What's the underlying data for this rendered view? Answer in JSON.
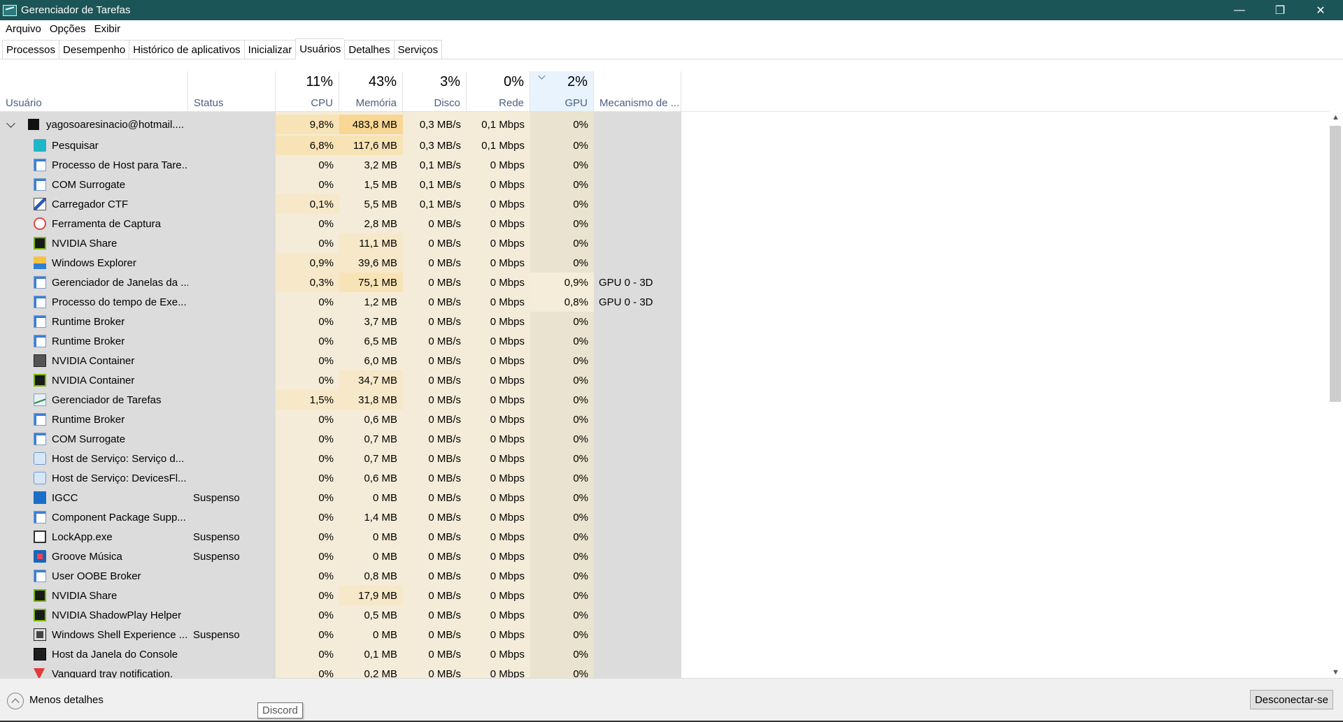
{
  "window": {
    "title": "Gerenciador de Tarefas",
    "minimize": "—",
    "restore": "❐",
    "close": "✕"
  },
  "menu": [
    "Arquivo",
    "Opções",
    "Exibir"
  ],
  "tabs": [
    "Processos",
    "Desempenho",
    "Histórico de aplicativos",
    "Inicializar",
    "Usuários",
    "Detalhes",
    "Serviços"
  ],
  "active_tab": "Usuários",
  "header": {
    "user": "Usuário",
    "status": "Status",
    "cpu_pct": "11%",
    "cpu": "CPU",
    "mem_pct": "43%",
    "mem": "Memória",
    "disk_pct": "3%",
    "disk": "Disco",
    "net_pct": "0%",
    "net": "Rede",
    "gpu_pct": "2%",
    "gpu": "GPU",
    "engine": "Mecanismo de ..."
  },
  "user_row": {
    "name": "yagosoaresinacio@hotmail....",
    "cpu": "9,8%",
    "mem": "483,8 MB",
    "disk": "0,3 MB/s",
    "net": "0,1 Mbps",
    "gpu": "0%"
  },
  "processes": [
    {
      "name": "Pesquisar",
      "icon": "search-app-icon",
      "status": "",
      "cpu": "6,8%",
      "mem": "117,6 MB",
      "disk": "0,3 MB/s",
      "net": "0,1 Mbps",
      "gpu": "0%",
      "engine": ""
    },
    {
      "name": "Processo de Host para Tare...",
      "icon": "window-app-icon",
      "status": "",
      "cpu": "0%",
      "mem": "3,2 MB",
      "disk": "0,1 MB/s",
      "net": "0 Mbps",
      "gpu": "0%",
      "engine": ""
    },
    {
      "name": "COM Surrogate",
      "icon": "window-app-icon",
      "status": "",
      "cpu": "0%",
      "mem": "1,5 MB",
      "disk": "0,1 MB/s",
      "net": "0 Mbps",
      "gpu": "0%",
      "engine": ""
    },
    {
      "name": "Carregador CTF",
      "icon": "pen-app-icon",
      "status": "",
      "cpu": "0,1%",
      "mem": "5,5 MB",
      "disk": "0,1 MB/s",
      "net": "0 Mbps",
      "gpu": "0%",
      "engine": ""
    },
    {
      "name": "Ferramenta de Captura",
      "icon": "scissors-app-icon",
      "status": "",
      "cpu": "0%",
      "mem": "2,8 MB",
      "disk": "0 MB/s",
      "net": "0 Mbps",
      "gpu": "0%",
      "engine": ""
    },
    {
      "name": "NVIDIA Share",
      "icon": "nvidia-app-icon",
      "status": "",
      "cpu": "0%",
      "mem": "11,1 MB",
      "disk": "0 MB/s",
      "net": "0 Mbps",
      "gpu": "0%",
      "engine": ""
    },
    {
      "name": "Windows Explorer",
      "icon": "folder-app-icon",
      "status": "",
      "cpu": "0,9%",
      "mem": "39,6 MB",
      "disk": "0 MB/s",
      "net": "0 Mbps",
      "gpu": "0%",
      "engine": ""
    },
    {
      "name": "Gerenciador de Janelas da ...",
      "icon": "window-app-icon",
      "status": "",
      "cpu": "0,3%",
      "mem": "75,1 MB",
      "disk": "0 MB/s",
      "net": "0 Mbps",
      "gpu": "0,9%",
      "engine": "GPU 0 - 3D"
    },
    {
      "name": "Processo do tempo de Exe...",
      "icon": "window-app-icon",
      "status": "",
      "cpu": "0%",
      "mem": "1,2 MB",
      "disk": "0 MB/s",
      "net": "0 Mbps",
      "gpu": "0,8%",
      "engine": "GPU 0 - 3D"
    },
    {
      "name": "Runtime Broker",
      "icon": "window-app-icon",
      "status": "",
      "cpu": "0%",
      "mem": "3,7 MB",
      "disk": "0 MB/s",
      "net": "0 Mbps",
      "gpu": "0%",
      "engine": ""
    },
    {
      "name": "Runtime Broker",
      "icon": "window-app-icon",
      "status": "",
      "cpu": "0%",
      "mem": "6,5 MB",
      "disk": "0 MB/s",
      "net": "0 Mbps",
      "gpu": "0%",
      "engine": ""
    },
    {
      "name": "NVIDIA Container",
      "icon": "container-app-icon",
      "status": "",
      "cpu": "0%",
      "mem": "6,0 MB",
      "disk": "0 MB/s",
      "net": "0 Mbps",
      "gpu": "0%",
      "engine": ""
    },
    {
      "name": "NVIDIA Container",
      "icon": "nvidia-app-icon",
      "status": "",
      "cpu": "0%",
      "mem": "34,7 MB",
      "disk": "0 MB/s",
      "net": "0 Mbps",
      "gpu": "0%",
      "engine": ""
    },
    {
      "name": "Gerenciador de Tarefas",
      "icon": "taskmgr-app-icon",
      "status": "",
      "cpu": "1,5%",
      "mem": "31,8 MB",
      "disk": "0 MB/s",
      "net": "0 Mbps",
      "gpu": "0%",
      "engine": ""
    },
    {
      "name": "Runtime Broker",
      "icon": "window-app-icon",
      "status": "",
      "cpu": "0%",
      "mem": "0,6 MB",
      "disk": "0 MB/s",
      "net": "0 Mbps",
      "gpu": "0%",
      "engine": ""
    },
    {
      "name": "COM Surrogate",
      "icon": "window-app-icon",
      "status": "",
      "cpu": "0%",
      "mem": "0,7 MB",
      "disk": "0 MB/s",
      "net": "0 Mbps",
      "gpu": "0%",
      "engine": ""
    },
    {
      "name": "Host de Serviço: Serviço d...",
      "icon": "gear-app-icon",
      "status": "",
      "cpu": "0%",
      "mem": "0,7 MB",
      "disk": "0 MB/s",
      "net": "0 Mbps",
      "gpu": "0%",
      "engine": ""
    },
    {
      "name": "Host de Serviço: DevicesFl...",
      "icon": "gear-app-icon",
      "status": "",
      "cpu": "0%",
      "mem": "0,6 MB",
      "disk": "0 MB/s",
      "net": "0 Mbps",
      "gpu": "0%",
      "engine": ""
    },
    {
      "name": "IGCC",
      "icon": "igcc-app-icon",
      "status": "Suspenso",
      "cpu": "0%",
      "mem": "0 MB",
      "disk": "0 MB/s",
      "net": "0 Mbps",
      "gpu": "0%",
      "engine": ""
    },
    {
      "name": "Component Package Supp...",
      "icon": "window-app-icon",
      "status": "",
      "cpu": "0%",
      "mem": "1,4 MB",
      "disk": "0 MB/s",
      "net": "0 Mbps",
      "gpu": "0%",
      "engine": ""
    },
    {
      "name": "LockApp.exe",
      "icon": "blank-app-icon",
      "status": "Suspenso",
      "cpu": "0%",
      "mem": "0 MB",
      "disk": "0 MB/s",
      "net": "0 Mbps",
      "gpu": "0%",
      "engine": ""
    },
    {
      "name": "Groove Música",
      "icon": "music-app-icon",
      "status": "Suspenso",
      "cpu": "0%",
      "mem": "0 MB",
      "disk": "0 MB/s",
      "net": "0 Mbps",
      "gpu": "0%",
      "engine": ""
    },
    {
      "name": "User OOBE Broker",
      "icon": "window-app-icon",
      "status": "",
      "cpu": "0%",
      "mem": "0,8 MB",
      "disk": "0 MB/s",
      "net": "0 Mbps",
      "gpu": "0%",
      "engine": ""
    },
    {
      "name": "NVIDIA Share",
      "icon": "nvidia-app-icon",
      "status": "",
      "cpu": "0%",
      "mem": "17,9 MB",
      "disk": "0 MB/s",
      "net": "0 Mbps",
      "gpu": "0%",
      "engine": ""
    },
    {
      "name": "NVIDIA ShadowPlay Helper",
      "icon": "nvidia-app-icon",
      "status": "",
      "cpu": "0%",
      "mem": "0,5 MB",
      "disk": "0 MB/s",
      "net": "0 Mbps",
      "gpu": "0%",
      "engine": ""
    },
    {
      "name": "Windows Shell Experience ...",
      "icon": "shell-app-icon",
      "status": "Suspenso",
      "cpu": "0%",
      "mem": "0 MB",
      "disk": "0 MB/s",
      "net": "0 Mbps",
      "gpu": "0%",
      "engine": ""
    },
    {
      "name": "Host da Janela do Console",
      "icon": "console-app-icon",
      "status": "",
      "cpu": "0%",
      "mem": "0,1 MB",
      "disk": "0 MB/s",
      "net": "0 Mbps",
      "gpu": "0%",
      "engine": ""
    },
    {
      "name": "Vanguard tray notification.",
      "icon": "vanguard-app-icon",
      "status": "",
      "cpu": "0%",
      "mem": "0,2 MB",
      "disk": "0 MB/s",
      "net": "0 Mbps",
      "gpu": "0%",
      "engine": ""
    }
  ],
  "footer": {
    "less_details": "Menos detalhes",
    "disconnect": "Desconectar-se"
  },
  "tooltip": "Discord",
  "colors": {
    "titlebar": "#1c5557",
    "heat_light": "#f9f1dd",
    "heat_medium": "#fbe9c0",
    "gpu_heat": "#e9e3cf",
    "gray_bg": "#dcdcdc"
  }
}
